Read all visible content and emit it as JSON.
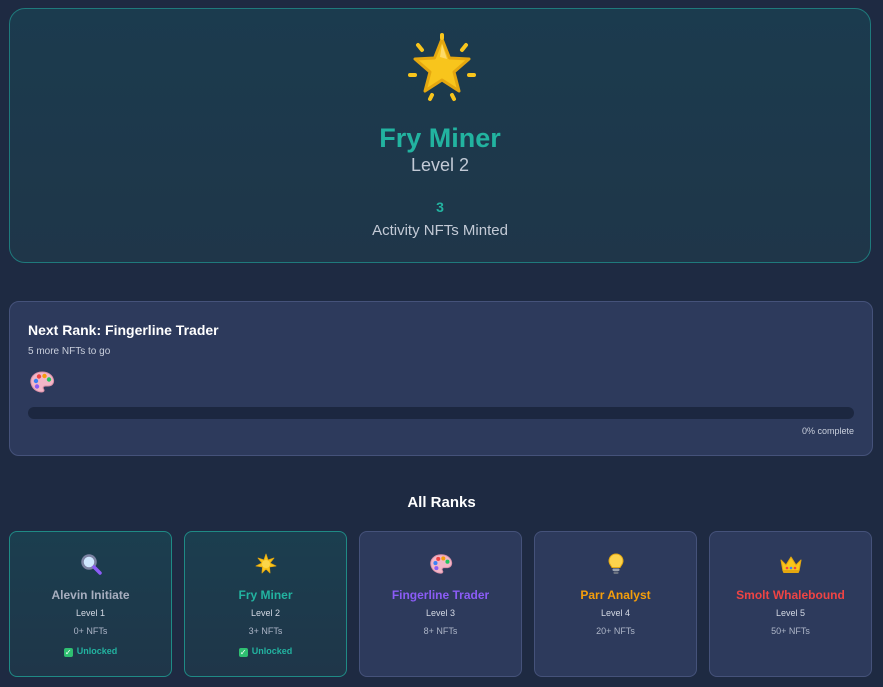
{
  "current_rank": {
    "icon": "star-icon",
    "name": "Fry Miner",
    "level": "Level 2",
    "count": "3",
    "count_label": "Activity NFTs Minted"
  },
  "next_rank": {
    "title": "Next Rank: Fingerline Trader",
    "subtitle": "5 more NFTs to go",
    "icon": "palette-icon",
    "progress_percent": 0,
    "progress_text": "0% complete"
  },
  "all_ranks": {
    "title": "All Ranks",
    "ranks": [
      {
        "icon": "magnifier-icon",
        "name": "Alevin Initiate",
        "level": "Level 1",
        "requirement": "0+ NFTs",
        "status": "Unlocked",
        "unlocked": true,
        "color": "#a7aebf"
      },
      {
        "icon": "sparkle-sun-icon",
        "name": "Fry Miner",
        "level": "Level 2",
        "requirement": "3+ NFTs",
        "status": "Unlocked",
        "unlocked": true,
        "color": "#22b3a0"
      },
      {
        "icon": "palette-icon",
        "name": "Fingerline Trader",
        "level": "Level 3",
        "requirement": "8+ NFTs",
        "status": "",
        "unlocked": false,
        "color": "#8b5cf6"
      },
      {
        "icon": "lightbulb-icon",
        "name": "Parr Analyst",
        "level": "Level 4",
        "requirement": "20+ NFTs",
        "status": "",
        "unlocked": false,
        "color": "#f59e0b"
      },
      {
        "icon": "crown-icon",
        "name": "Smolt Whalebound",
        "level": "Level 5",
        "requirement": "50+ NFTs",
        "status": "",
        "unlocked": false,
        "color": "#ef4444"
      }
    ]
  },
  "colors": {
    "accent": "#22b3a0",
    "background": "#1e2a42",
    "card": "#2d3a5c"
  }
}
